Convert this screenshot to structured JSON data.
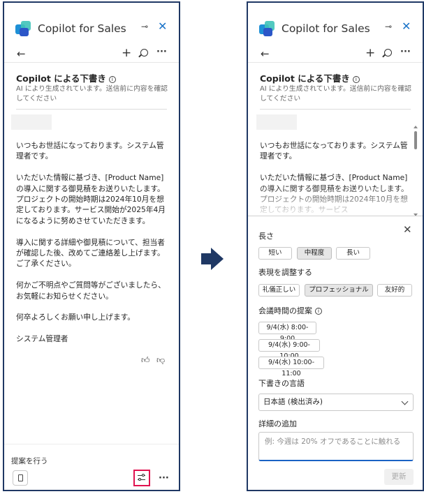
{
  "app": {
    "title": "Copilot for Sales"
  },
  "draft": {
    "title": "Copilot による下書き",
    "subtitle": "AI により生成されています。送信前に内容を確認してください"
  },
  "email_left": {
    "paragraphs": [
      "いつもお世話になっております。システム管理者です。",
      "いただいた情報に基づき、[Product Name]の導入に関する御見積をお送りいたします。プロジェクトの開始時期は2024年10月を想定しております。サービス開始が2025年4月になるように努めさせていただきます。",
      "導入に関する詳細や御見積について、担当者が確認した後、改めてご連絡差し上げます。ご了承ください。",
      "何かご不明点やご質問等がございましたら、お気軽にお知らせください。",
      "何卒よろしくお願い申し上げます。",
      "システム管理者"
    ]
  },
  "email_right": {
    "paragraphs": [
      "いつもお世話になっております。システム管理者です。",
      "いただいた情報に基づき、[Product Name]の導入に関する御見積をお送りいたします。プロジェクトの開始時期は2024年10月を想定しております。サービス"
    ]
  },
  "footer": {
    "suggest_label": "提案を行う"
  },
  "icons": {
    "back": "arrow-left-icon",
    "new": "plus-icon",
    "search": "search-icon",
    "more": "more-icon",
    "pin": "pin-icon",
    "close": "close-icon",
    "like": "thumbs-up-icon",
    "dislike": "thumbs-down-icon",
    "copy": "copy-icon",
    "tune": "tune-icon",
    "arrow": "right-arrow-icon"
  },
  "tune_panel": {
    "length": {
      "label": "長さ",
      "options": [
        "短い",
        "中程度",
        "長い"
      ],
      "selected": "中程度"
    },
    "tone": {
      "label": "表現を調整する",
      "options": [
        "礼儀正しい",
        "プロフェッショナル",
        "友好的"
      ],
      "selected": "プロフェッショナル"
    },
    "meeting": {
      "label": "会議時間の提案",
      "options": [
        "9/4(水) 8:00-9:00",
        "9/4(水) 9:00-10:00",
        "9/4(水) 10:00-11:00"
      ]
    },
    "language": {
      "label": "下書きの言語",
      "value": "日本語 (検出済み)"
    },
    "details": {
      "label": "詳細の追加",
      "placeholder": "例: 今週は 20% オフであることに触れる"
    },
    "update_label": "更新"
  },
  "colors": {
    "accent": "#1a62c4",
    "highlight": "#e0114f",
    "border": "#1f3864",
    "arrow": "#1f3864"
  }
}
